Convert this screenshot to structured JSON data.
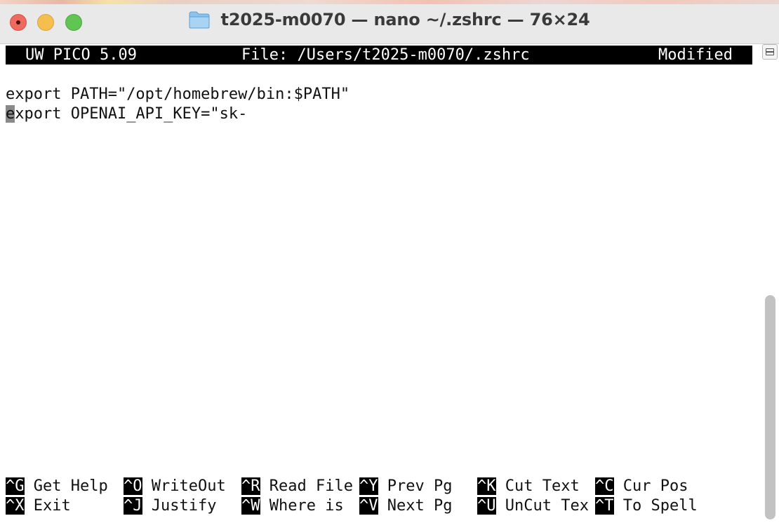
{
  "window": {
    "title": "t2025-m0070 — nano ~/.zshrc — 76×24",
    "folder_icon": "folder-icon",
    "controls": {
      "close": "close-button",
      "minimize": "minimize-button",
      "zoom": "zoom-button"
    }
  },
  "editor": {
    "app_version": "UW PICO 5.09",
    "file_label": "File: /Users/t2025-m0070/.zshrc",
    "status": "Modified",
    "lines": [
      "export PATH=\"/opt/homebrew/bin:$PATH\"",
      "export OPENAI_API_KEY=\"sk-"
    ],
    "line2_cursor_char": "e",
    "line2_rest": "xport OPENAI_API_KEY=\"sk-"
  },
  "shortcuts": [
    [
      {
        "key": "^G",
        "label": " Get Help"
      },
      {
        "key": "^O",
        "label": " WriteOut"
      },
      {
        "key": "^R",
        "label": " Read File"
      },
      {
        "key": "^Y",
        "label": " Prev Pg"
      },
      {
        "key": "^K",
        "label": " Cut Text"
      },
      {
        "key": "^C",
        "label": " Cur Pos"
      }
    ],
    [
      {
        "key": "^X",
        "label": " Exit"
      },
      {
        "key": "^J",
        "label": " Justify"
      },
      {
        "key": "^W",
        "label": " Where is"
      },
      {
        "key": "^V",
        "label": " Next Pg"
      },
      {
        "key": "^U",
        "label": " UnCut Tex"
      },
      {
        "key": "^T",
        "label": " To Spell"
      }
    ]
  ],
  "colors": {
    "close": "#ed6a5e",
    "minimize": "#f5bf4f",
    "zoom": "#61c554",
    "inverse_bg": "#000000",
    "inverse_fg": "#ffffff",
    "cursor": "#8a8a8a",
    "scroll_thumb": "#c2c2c2"
  },
  "scrollbar": {
    "thumb_position_fraction": 0.5
  }
}
